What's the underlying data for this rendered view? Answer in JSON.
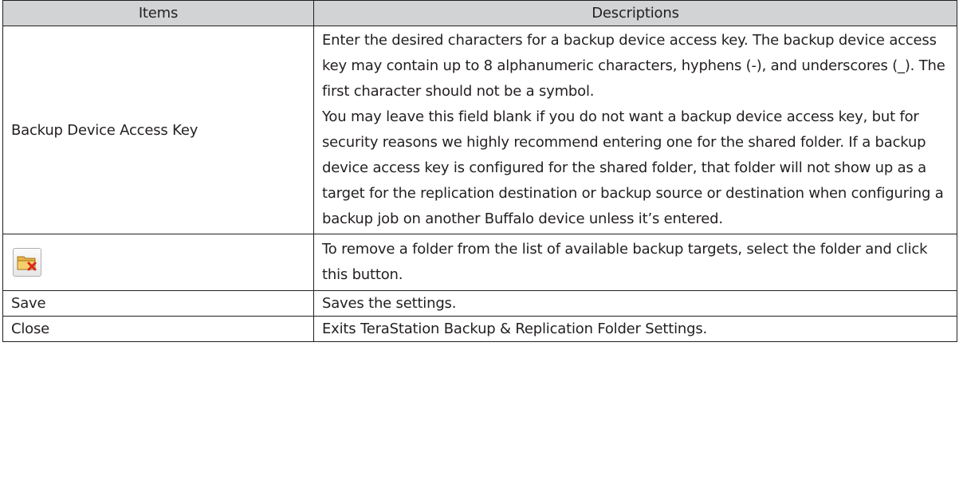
{
  "table": {
    "headers": {
      "items": "Items",
      "descriptions": "Descriptions"
    },
    "rows": [
      {
        "item": "Backup Device Access Key",
        "description_paragraphs": [
          "Enter the desired characters for a backup device access key. The backup device access key may contain up to 8 alphanumeric characters, hyphens (-), and underscores (_). The first character should not be a symbol.",
          "You may leave this field blank if you do not want a backup device access key, but for security reasons we highly recommend entering one for the shared folder. If a backup device access key is configured for the shared folder, that folder will not show up as a target for the replication destination or backup source or destination when configuring a backup job on another Buffalo device unless it’s entered."
        ]
      },
      {
        "item_icon": "remove-folder-icon",
        "description": "To remove a folder from the list of available backup targets, select the folder and click this button."
      },
      {
        "item": "Save",
        "description": "Saves the settings."
      },
      {
        "item": "Close",
        "description": "Exits TeraStation Backup & Replication Folder Settings."
      }
    ]
  },
  "colors": {
    "header_background": "#d1d3d4",
    "border": "#231f20",
    "text": "#231f20"
  }
}
